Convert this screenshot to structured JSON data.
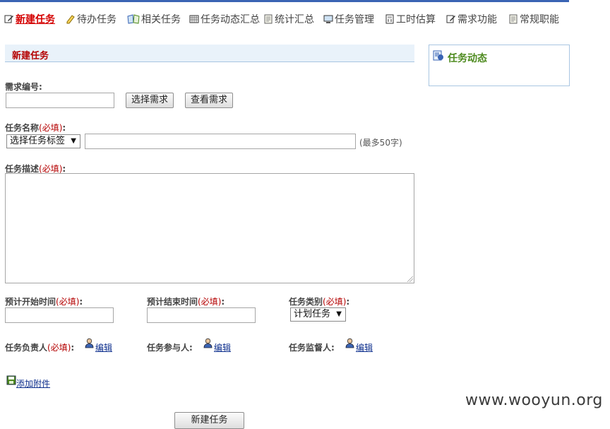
{
  "nav": {
    "items": [
      {
        "label": "新建任务",
        "icon": "edit-icon"
      },
      {
        "label": "待办任务",
        "icon": "pencil-icon"
      },
      {
        "label": "相关任务",
        "icon": "book-icon"
      },
      {
        "label": "任务动态汇总",
        "icon": "calendar-icon"
      },
      {
        "label": "统计汇总",
        "icon": "document-icon"
      },
      {
        "label": "任务管理",
        "icon": "monitor-icon"
      },
      {
        "label": "工时估算",
        "icon": "calculator-icon"
      },
      {
        "label": "需求功能",
        "icon": "edit-icon"
      },
      {
        "label": "常规职能",
        "icon": "document-icon"
      }
    ],
    "active_index": 0
  },
  "form": {
    "section_title": "新建任务",
    "required_mark": "(必填)",
    "demand_no": {
      "label": "需求编号:",
      "value": "",
      "select_button": "选择需求",
      "view_button": "查看需求"
    },
    "task_name": {
      "label": "任务名称",
      "select_value": "选择任务标签",
      "value": "",
      "hint": "(最多50字)"
    },
    "task_desc": {
      "label": "任务描述",
      "value": ""
    },
    "start_time": {
      "label": "预计开始时间",
      "value": ""
    },
    "end_time": {
      "label": "预计结束时间",
      "value": ""
    },
    "task_type": {
      "label": "任务类别",
      "value": "计划任务"
    },
    "owner": {
      "label": "任务负责人",
      "edit": "编辑"
    },
    "participants": {
      "label": "任务参与人:",
      "edit": "编辑"
    },
    "supervisor": {
      "label": "任务监督人:",
      "edit": "编辑"
    },
    "attachment_link": "添加附件",
    "submit_button": "新建任务"
  },
  "side_panel": {
    "title": "任务动态",
    "icon": "news-icon"
  },
  "watermark": "www.wooyun.org",
  "colors": {
    "accent_blue": "#3a64b4",
    "required_red": "#b40000",
    "panel_title_green": "#4d8a1e",
    "header_bg": "#e9f2fa"
  }
}
